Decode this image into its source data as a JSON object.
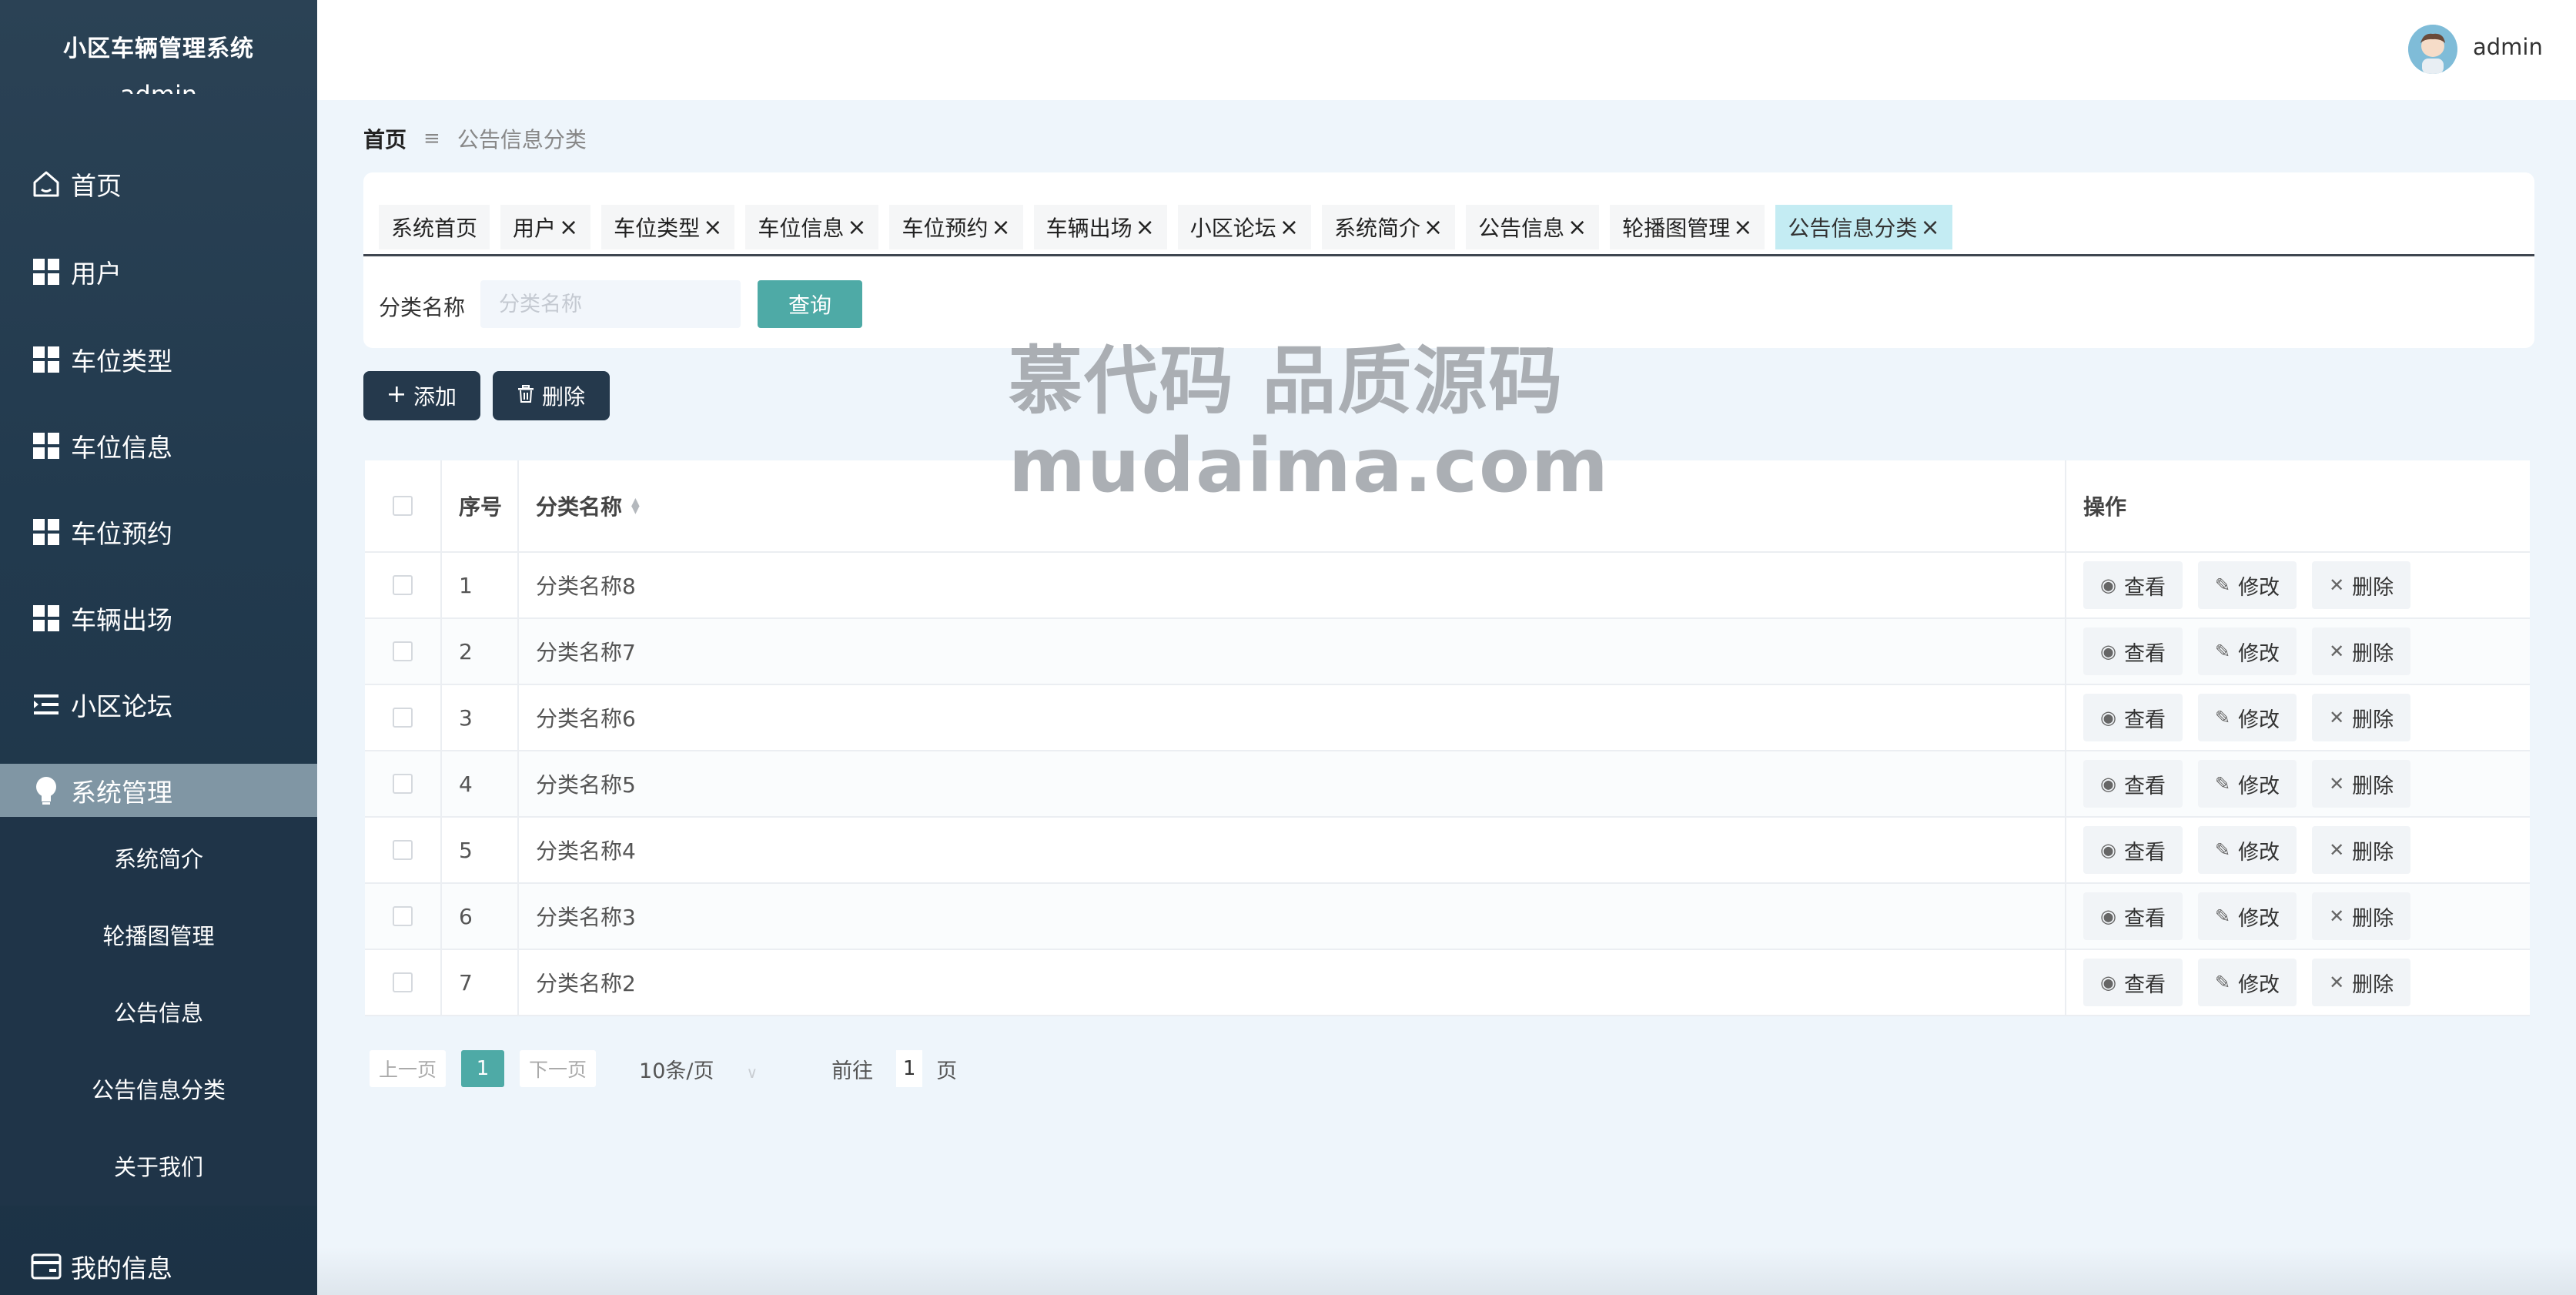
{
  "app": {
    "title": "小区车辆管理系统",
    "user_ghost": "admin"
  },
  "sidebar": {
    "items": [
      {
        "label": "首页",
        "icon": "home-icon"
      },
      {
        "label": "用户",
        "icon": "grid-icon"
      },
      {
        "label": "车位类型",
        "icon": "grid-icon"
      },
      {
        "label": "车位信息",
        "icon": "grid-icon"
      },
      {
        "label": "车位预约",
        "icon": "grid-icon"
      },
      {
        "label": "车辆出场",
        "icon": "grid-icon"
      },
      {
        "label": "小区论坛",
        "icon": "list-indent-icon"
      },
      {
        "label": "系统管理",
        "icon": "bulb-icon",
        "active": true
      },
      {
        "label": "我的信息",
        "icon": "wallet-icon"
      }
    ],
    "submenu": [
      "系统简介",
      "轮播图管理",
      "公告信息",
      "公告信息分类",
      "关于我们"
    ]
  },
  "header": {
    "username": "admin"
  },
  "breadcrumb": {
    "home": "首页",
    "separator": "≡",
    "current": "公告信息分类"
  },
  "tabs": [
    {
      "label": "系统首页",
      "closable": false
    },
    {
      "label": "用户",
      "closable": true
    },
    {
      "label": "车位类型",
      "closable": true
    },
    {
      "label": "车位信息",
      "closable": true
    },
    {
      "label": "车位预约",
      "closable": true
    },
    {
      "label": "车辆出场",
      "closable": true
    },
    {
      "label": "小区论坛",
      "closable": true
    },
    {
      "label": "系统简介",
      "closable": true
    },
    {
      "label": "公告信息",
      "closable": true
    },
    {
      "label": "轮播图管理",
      "closable": true
    },
    {
      "label": "公告信息分类",
      "closable": true,
      "active": true
    }
  ],
  "search": {
    "label": "分类名称",
    "placeholder": "分类名称",
    "value": "",
    "button": "查询"
  },
  "actions": {
    "add": "添加",
    "delete": "删除"
  },
  "watermark": {
    "line1": "慕代码 品质源码",
    "line2": "mudaima.com"
  },
  "table": {
    "columns": {
      "index": "序号",
      "name": "分类名称",
      "ops": "操作"
    },
    "rows": [
      {
        "index": "1",
        "name": "分类名称8"
      },
      {
        "index": "2",
        "name": "分类名称7"
      },
      {
        "index": "3",
        "name": "分类名称6"
      },
      {
        "index": "4",
        "name": "分类名称5"
      },
      {
        "index": "5",
        "name": "分类名称4"
      },
      {
        "index": "6",
        "name": "分类名称3"
      },
      {
        "index": "7",
        "name": "分类名称2"
      }
    ],
    "row_actions": {
      "view": "查看",
      "edit": "修改",
      "delete": "删除"
    }
  },
  "pagination": {
    "prev": "上一页",
    "current": "1",
    "next": "下一页",
    "page_size": "10条/页",
    "goto": "前往",
    "goto_value": "1",
    "unit": "页"
  },
  "colors": {
    "sidebar": "#223a4e",
    "accent": "#4eaaa6",
    "active_tab": "#c4ecf3",
    "dark_button": "#25394c"
  }
}
